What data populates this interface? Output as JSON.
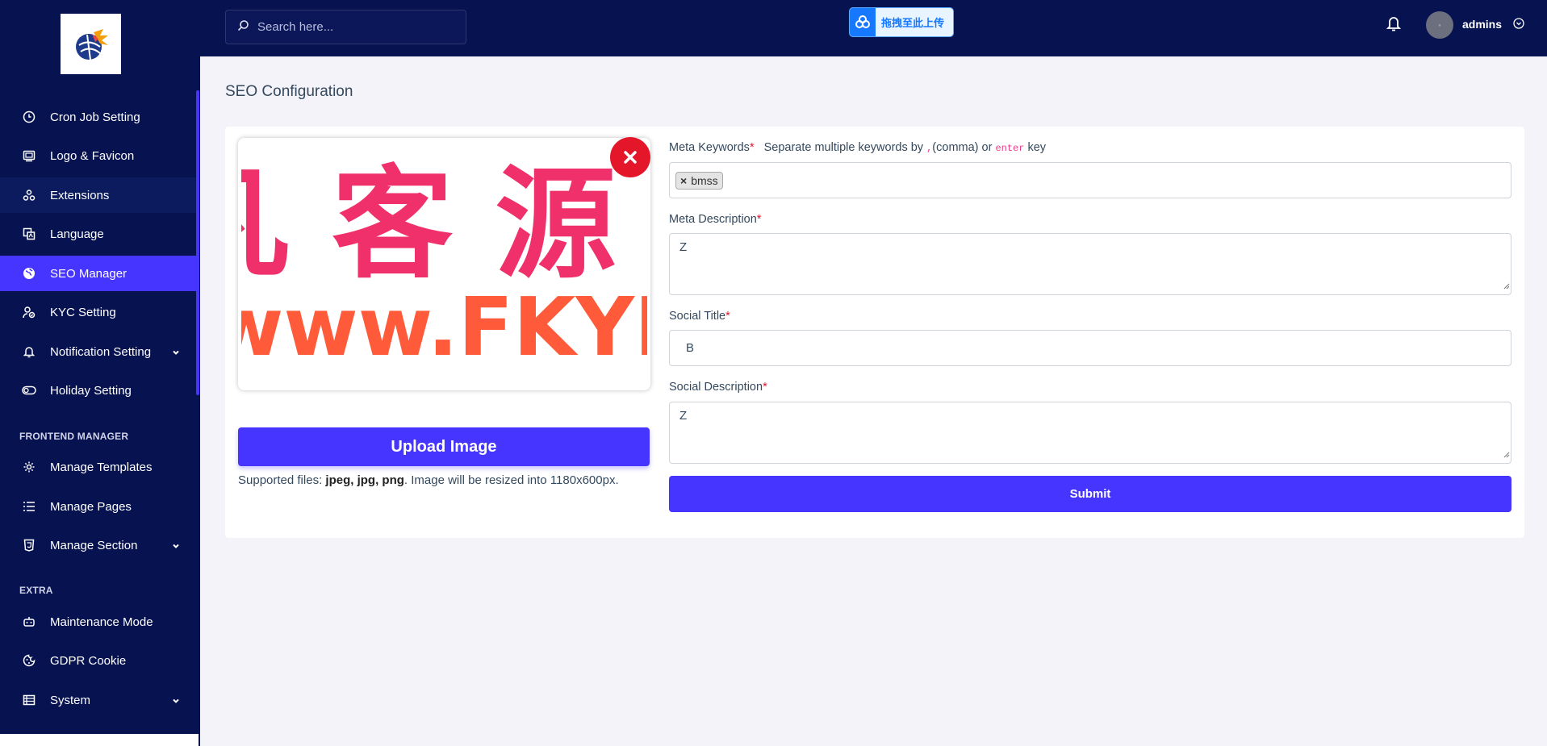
{
  "sidebar": {
    "items": [
      {
        "label": "Cron Job Setting",
        "icon": "clock-icon"
      },
      {
        "label": "Logo & Favicon",
        "icon": "image-icon"
      },
      {
        "label": "Extensions",
        "icon": "puzzle-icon"
      },
      {
        "label": "Language",
        "icon": "language-icon"
      },
      {
        "label": "SEO Manager",
        "icon": "globe-icon"
      },
      {
        "label": "KYC Setting",
        "icon": "user-check-icon"
      },
      {
        "label": "Notification Setting",
        "icon": "bell-icon"
      },
      {
        "label": "Holiday Setting",
        "icon": "toggle-icon"
      }
    ],
    "frontend_title": "FRONTEND MANAGER",
    "frontend_items": [
      {
        "label": "Manage Templates",
        "icon": "gear-icon"
      },
      {
        "label": "Manage Pages",
        "icon": "list-icon"
      },
      {
        "label": "Manage Section",
        "icon": "html5-icon"
      }
    ],
    "extra_title": "EXTRA",
    "extra_items": [
      {
        "label": "Maintenance Mode",
        "icon": "robot-icon"
      },
      {
        "label": "GDPR Cookie",
        "icon": "cookie-icon"
      },
      {
        "label": "System",
        "icon": "server-icon"
      }
    ],
    "active_color": "#4634ff",
    "bg_color": "#071251"
  },
  "topbar": {
    "search_placeholder": "Search here...",
    "upload_badge": "拖拽至此上传",
    "username": "admins"
  },
  "page": {
    "title": "SEO Configuration"
  },
  "form": {
    "image_text_line1": "凡 客 源",
    "image_text_line2": "www.FKYM",
    "upload_label": "Upload Image",
    "supported_prefix": "Supported files: ",
    "supported_types": "jpeg, jpg, png",
    "supported_suffix": ". Image will be resized into 1180x600px.",
    "meta_keywords_label": "Meta Keywords",
    "meta_keywords_hint_1": "Separate multiple keywords by ",
    "meta_keywords_hint_code1": ",",
    "meta_keywords_hint_2": "(comma) or ",
    "meta_keywords_hint_code2": "enter",
    "meta_keywords_hint_3": " key",
    "keywords": [
      "bmss"
    ],
    "meta_description_label": "Meta Description",
    "meta_description_value": "Z",
    "social_title_label": "Social Title",
    "social_title_value": "B",
    "social_description_label": "Social Description",
    "social_description_value": "Z",
    "submit_label": "Submit",
    "required_mark": "*"
  }
}
